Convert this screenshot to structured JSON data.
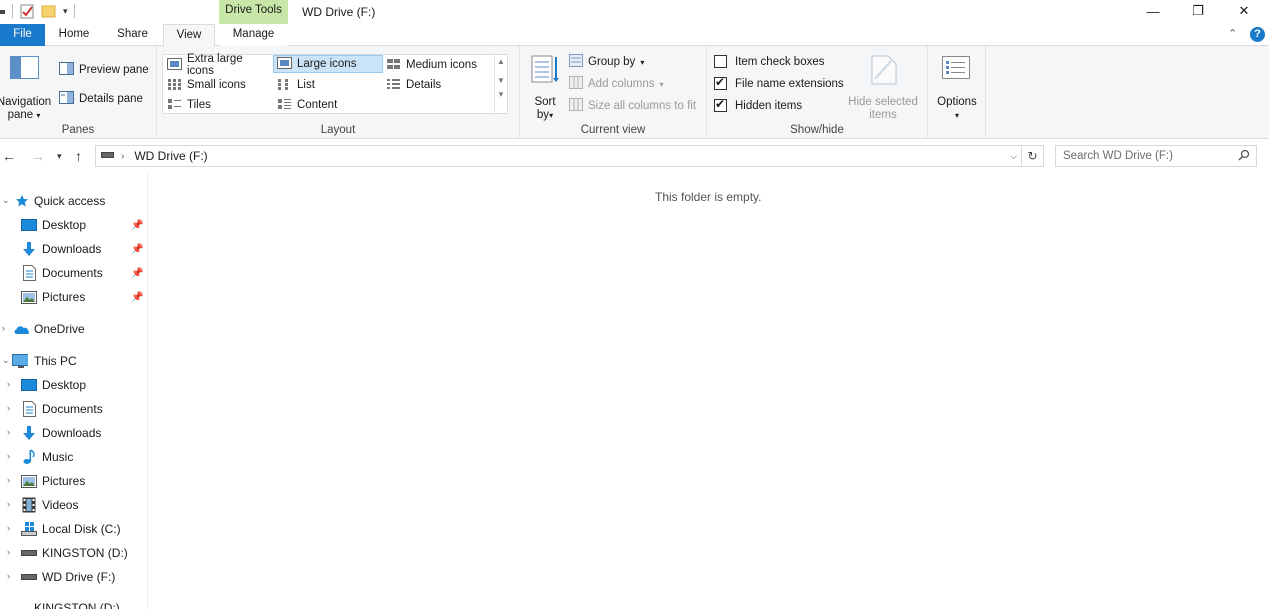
{
  "window": {
    "title": "WD Drive (F:)",
    "contextual_tab": "Drive Tools",
    "minimize": "—",
    "maximize": "❐",
    "close": "✕"
  },
  "tabs": [
    {
      "label": "File"
    },
    {
      "label": "Home"
    },
    {
      "label": "Share"
    },
    {
      "label": "View"
    },
    {
      "label": "Manage"
    }
  ],
  "active_tab": "View",
  "ribbon": {
    "panes": {
      "label": "Panes",
      "navigation_pane": "Navigation\npane",
      "navigation_pane_line1": "Navigation",
      "navigation_pane_line2": "pane",
      "preview_pane": "Preview pane",
      "details_pane": "Details pane"
    },
    "layout": {
      "label": "Layout",
      "items": [
        {
          "label": "Extra large icons"
        },
        {
          "label": "Large icons"
        },
        {
          "label": "Medium icons"
        },
        {
          "label": "Small icons"
        },
        {
          "label": "List"
        },
        {
          "label": "Details"
        },
        {
          "label": "Tiles"
        },
        {
          "label": "Content"
        }
      ],
      "selected": "Large icons"
    },
    "current_view": {
      "label": "Current view",
      "sort_by_line1": "Sort",
      "sort_by_line2": "by",
      "group_by": "Group by",
      "add_columns": "Add columns",
      "size_all_columns": "Size all columns to fit"
    },
    "show_hide": {
      "label": "Show/hide",
      "item_check_boxes": "Item check boxes",
      "item_check_boxes_checked": false,
      "file_name_extensions": "File name extensions",
      "file_name_extensions_checked": true,
      "hidden_items": "Hidden items",
      "hidden_items_checked": true,
      "hide_selected_line1": "Hide selected",
      "hide_selected_line2": "items"
    },
    "options": {
      "label": "Options"
    }
  },
  "address": {
    "path": "WD Drive (F:)",
    "search_placeholder": "Search WD Drive (F:)"
  },
  "nav_pane": {
    "items": [
      {
        "label": "Quick access",
        "icon": "star-icon",
        "level": 0,
        "expanded": true
      },
      {
        "label": "Desktop",
        "icon": "desktop-icon",
        "level": 1,
        "pinned": true
      },
      {
        "label": "Downloads",
        "icon": "download-icon",
        "level": 1,
        "pinned": true
      },
      {
        "label": "Documents",
        "icon": "document-icon",
        "level": 1,
        "pinned": true
      },
      {
        "label": "Pictures",
        "icon": "pictures-icon",
        "level": 1,
        "pinned": true
      },
      {
        "label": "OneDrive",
        "icon": "cloud-icon",
        "level": 0,
        "expanded": false
      },
      {
        "label": "This PC",
        "icon": "computer-icon",
        "level": 0,
        "expanded": true
      },
      {
        "label": "Desktop",
        "icon": "desktop-icon",
        "level": 1
      },
      {
        "label": "Documents",
        "icon": "document-icon",
        "level": 1
      },
      {
        "label": "Downloads",
        "icon": "download-icon",
        "level": 1
      },
      {
        "label": "Music",
        "icon": "music-icon",
        "level": 1
      },
      {
        "label": "Pictures",
        "icon": "pictures-icon",
        "level": 1
      },
      {
        "label": "Videos",
        "icon": "video-icon",
        "level": 1
      },
      {
        "label": "Local Disk (C:)",
        "icon": "system-drive-icon",
        "level": 1
      },
      {
        "label": "KINGSTON (D:)",
        "icon": "usb-drive-icon",
        "level": 1
      },
      {
        "label": "WD Drive (F:)",
        "icon": "usb-drive-icon",
        "level": 1
      },
      {
        "label": "KINGSTON (D:)",
        "icon": "usb-drive-icon",
        "level": 0
      }
    ]
  },
  "content": {
    "empty_message": "This folder is empty."
  },
  "colors": {
    "file_tab": "#1979ca",
    "drive_tools": "#c7e6a7",
    "selection": "#cce4f7",
    "ribbon_bg": "#f5f6f7"
  }
}
